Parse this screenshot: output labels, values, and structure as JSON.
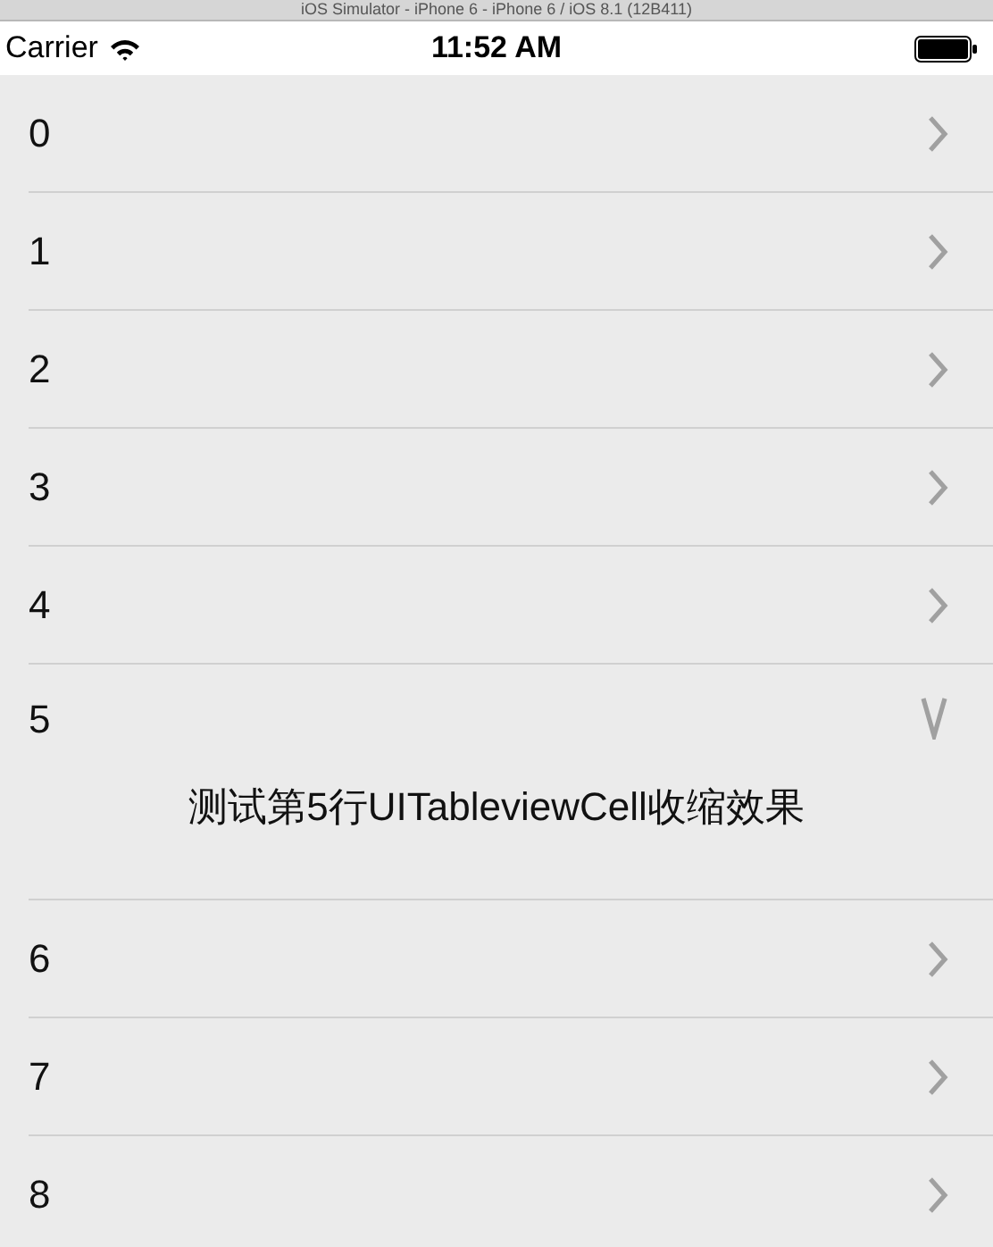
{
  "window": {
    "title": "iOS Simulator - iPhone 6 - iPhone 6 / iOS 8.1 (12B411)"
  },
  "status_bar": {
    "carrier": "Carrier",
    "time": "11:52 AM"
  },
  "rows": [
    {
      "label": "0",
      "expanded": false
    },
    {
      "label": "1",
      "expanded": false
    },
    {
      "label": "2",
      "expanded": false
    },
    {
      "label": "3",
      "expanded": false
    },
    {
      "label": "4",
      "expanded": false
    },
    {
      "label": "5",
      "expanded": true,
      "detail": "测试第5行UITableviewCell收缩效果"
    },
    {
      "label": "6",
      "expanded": false
    },
    {
      "label": "7",
      "expanded": false
    },
    {
      "label": "8",
      "expanded": false
    }
  ]
}
